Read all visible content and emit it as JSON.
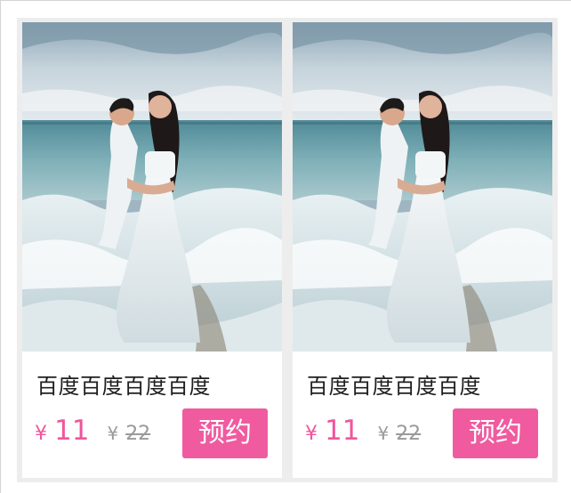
{
  "products": [
    {
      "title": "百度百度百度百度",
      "currency": "¥",
      "price": "11",
      "original_currency": "¥",
      "original_price": "22",
      "button_label": "预约"
    },
    {
      "title": "百度百度百度百度",
      "currency": "¥",
      "price": "11",
      "original_currency": "¥",
      "original_price": "22",
      "button_label": "预约"
    }
  ],
  "colors": {
    "accent": "#f05ba0",
    "price": "#f0569b",
    "muted": "#9a9a9a",
    "panel": "#ededed"
  }
}
